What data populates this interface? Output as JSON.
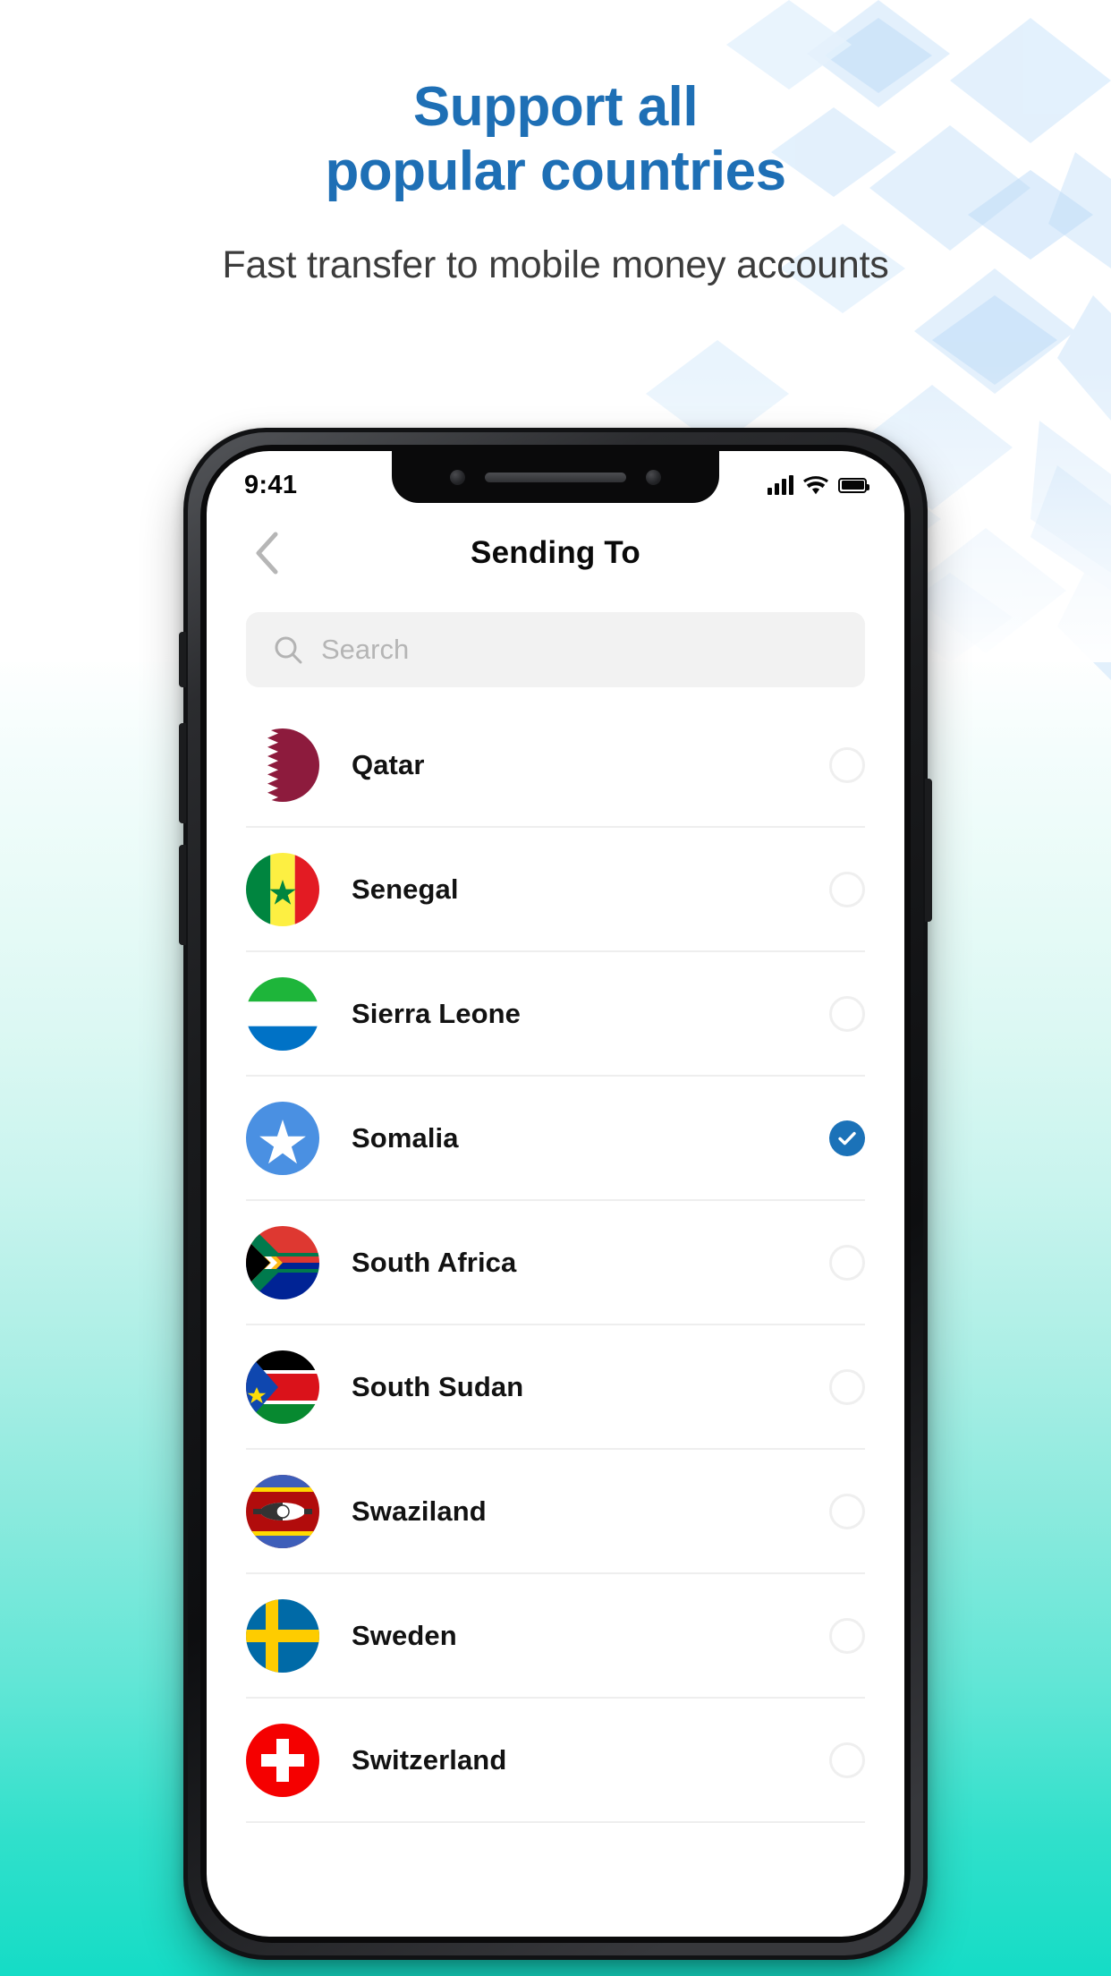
{
  "promo": {
    "headline_line1": "Support all",
    "headline_line2": "popular countries",
    "subheadline": "Fast transfer to mobile money accounts",
    "headline_color": "#1e6fb5",
    "subheadline_color": "#3c3c3c",
    "background_bottom_color": "#15dcc6"
  },
  "phone": {
    "status_bar": {
      "time": "9:41",
      "signal_icon": "cellular-signal-icon",
      "wifi_icon": "wifi-icon",
      "battery_icon": "battery-full-icon"
    },
    "navbar": {
      "back_icon": "chevron-left-icon",
      "title": "Sending To"
    },
    "search": {
      "icon": "search-icon",
      "placeholder": "Search",
      "value": ""
    },
    "accent_color": "#1b72b8",
    "list": {
      "items": [
        {
          "name": "Qatar",
          "flag": "qatar-flag-icon",
          "selected": false,
          "radio_icon": "radio-empty-icon"
        },
        {
          "name": "Senegal",
          "flag": "senegal-flag-icon",
          "selected": false,
          "radio_icon": "radio-empty-icon"
        },
        {
          "name": "Sierra Leone",
          "flag": "sierra-leone-flag-icon",
          "selected": false,
          "radio_icon": "radio-empty-icon"
        },
        {
          "name": "Somalia",
          "flag": "somalia-flag-icon",
          "selected": true,
          "radio_icon": "check-circle-icon"
        },
        {
          "name": "South Africa",
          "flag": "south-africa-flag-icon",
          "selected": false,
          "radio_icon": "radio-empty-icon"
        },
        {
          "name": "South Sudan",
          "flag": "south-sudan-flag-icon",
          "selected": false,
          "radio_icon": "radio-empty-icon"
        },
        {
          "name": "Swaziland",
          "flag": "swaziland-flag-icon",
          "selected": false,
          "radio_icon": "radio-empty-icon"
        },
        {
          "name": "Sweden",
          "flag": "sweden-flag-icon",
          "selected": false,
          "radio_icon": "radio-empty-icon"
        },
        {
          "name": "Switzerland",
          "flag": "switzerland-flag-icon",
          "selected": false,
          "radio_icon": "radio-empty-icon"
        }
      ]
    }
  }
}
